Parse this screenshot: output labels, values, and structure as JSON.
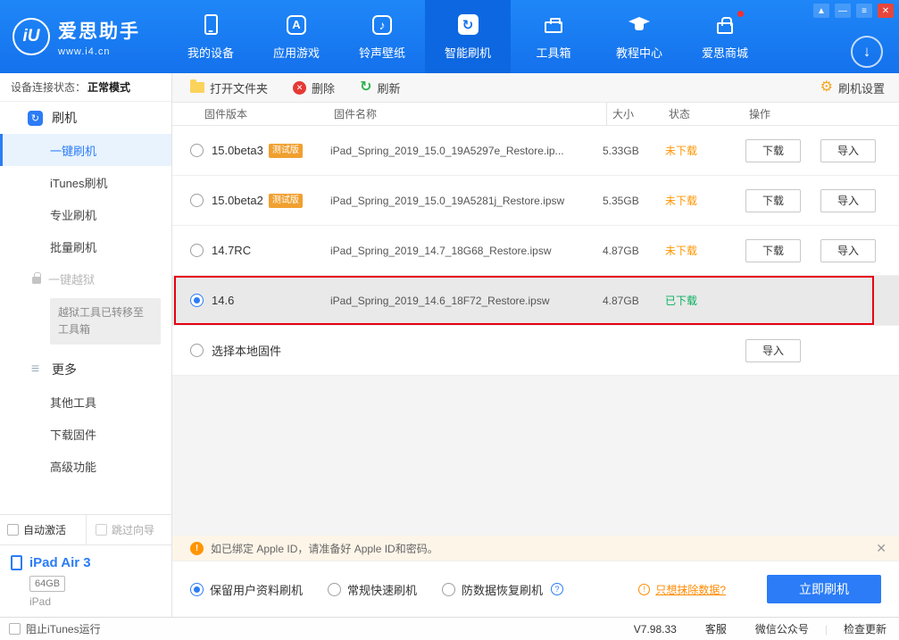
{
  "colors": {
    "accent_blue": "#2b7cf6",
    "topbar_blue": "#1a7df2",
    "warn_orange": "#ff9502",
    "success_green": "#0ab05f",
    "selected_border_red": "#e60012",
    "link_orange": "#ff8a00",
    "badge_orange": "#f0a030"
  },
  "glyphs": {
    "pin": "▲",
    "minimize": "—",
    "menu": "≡",
    "close": "✕",
    "download_arrow": "↓",
    "delete_x": "✕",
    "refresh": "↻",
    "gear": "⚙",
    "music_note": "♪",
    "letter_a": "A",
    "flash": "↻",
    "warning": "!",
    "question": "?",
    "info": "!",
    "hamburger": "≡",
    "notice_close": "✕"
  },
  "topbar": {
    "logo": {
      "monogram": "iU",
      "title": "爱思助手",
      "subtitle": "www.i4.cn"
    },
    "nav": [
      {
        "label": "我的设备",
        "icon": "device-icon"
      },
      {
        "label": "应用游戏",
        "icon": "apps-icon"
      },
      {
        "label": "铃声壁纸",
        "icon": "ringtone-icon"
      },
      {
        "label": "智能刷机",
        "icon": "smart-flash-icon",
        "active": true
      },
      {
        "label": "工具箱",
        "icon": "toolbox-icon"
      },
      {
        "label": "教程中心",
        "icon": "tutorial-icon"
      },
      {
        "label": "爱思商城",
        "icon": "mall-icon",
        "notification_dot": true
      }
    ]
  },
  "sidebar": {
    "connection_label": "设备连接状态：",
    "connection_value": "正常模式",
    "flash_section": "刷机",
    "items": [
      "一键刷机",
      "iTunes刷机",
      "专业刷机",
      "批量刷机"
    ],
    "active_item": "一键刷机",
    "jailbreak_item": "一键越狱",
    "jailbreak_note": "越狱工具已转移至工具箱",
    "more_section": "更多",
    "more_items": [
      "其他工具",
      "下载固件",
      "高级功能"
    ],
    "auto_activate": "自动激活",
    "skip_wizard": "跳过向导",
    "device_name": "iPad Air 3",
    "device_capacity": "64GB",
    "device_model": "iPad"
  },
  "firmware_table": {
    "toolbar": {
      "open_folder": "打开文件夹",
      "delete": "删除",
      "refresh": "刷新",
      "settings": "刷机设置"
    },
    "headers": [
      "固件版本",
      "固件名称",
      "大小",
      "状态",
      "操作"
    ],
    "rows": [
      {
        "version": "15.0beta3",
        "badge": "测试版",
        "name": "iPad_Spring_2019_15.0_19A5297e_Restore.ip...",
        "size": "5.33GB",
        "status": "未下载",
        "actions": [
          "下载",
          "导入"
        ],
        "selected": false
      },
      {
        "version": "15.0beta2",
        "badge": "测试版",
        "name": "iPad_Spring_2019_15.0_19A5281j_Restore.ipsw",
        "size": "5.35GB",
        "status": "未下载",
        "actions": [
          "下载",
          "导入"
        ],
        "selected": false
      },
      {
        "version": "14.7RC",
        "badge": "",
        "name": "iPad_Spring_2019_14.7_18G68_Restore.ipsw",
        "size": "4.87GB",
        "status": "未下载",
        "actions": [
          "下载",
          "导入"
        ],
        "selected": false
      },
      {
        "version": "14.6",
        "badge": "",
        "name": "iPad_Spring_2019_14.6_18F72_Restore.ipsw",
        "size": "4.87GB",
        "status": "已下载",
        "actions": [],
        "selected": true
      },
      {
        "version": "选择本地固件",
        "badge": "",
        "name": "",
        "size": "",
        "status": "",
        "actions": [
          "导入"
        ],
        "selected": false
      }
    ]
  },
  "notice": {
    "text": "如已绑定 Apple ID，请准备好 Apple ID和密码。"
  },
  "flash_panel": {
    "modes": [
      "保留用户资料刷机",
      "常规快速刷机",
      "防数据恢复刷机"
    ],
    "selected_mode": "保留用户资料刷机",
    "erase_link": "只想抹除数据?",
    "flash_button": "立即刷机"
  },
  "statusbar": {
    "block_itunes": "阻止iTunes运行",
    "version": "V7.98.33",
    "support": "客服",
    "wechat": "微信公众号",
    "check_update": "检查更新"
  }
}
